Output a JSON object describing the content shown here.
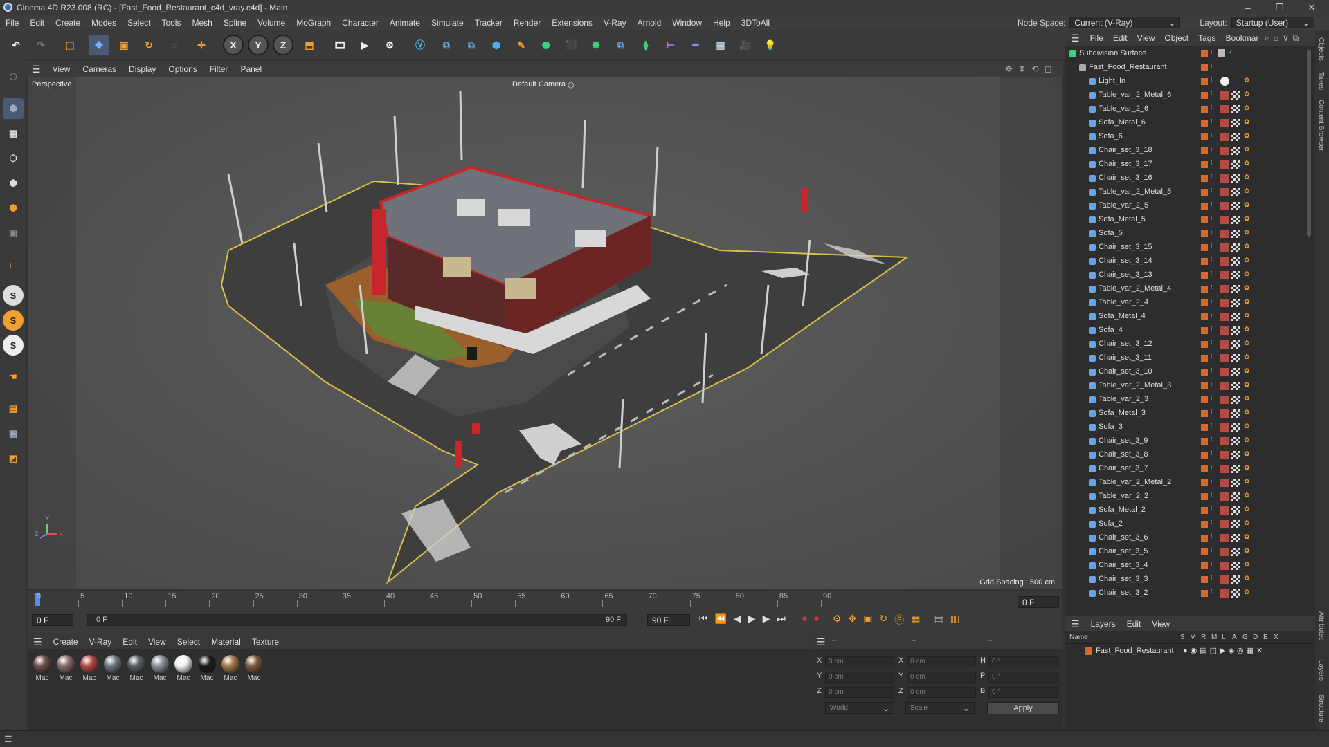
{
  "window": {
    "title": "Cinema 4D R23.008 (RC) - [Fast_Food_Restaurant_c4d_vray.c4d] - Main",
    "controls": [
      "–",
      "❐",
      "✕"
    ]
  },
  "menubar": {
    "items": [
      "File",
      "Edit",
      "Create",
      "Modes",
      "Select",
      "Tools",
      "Mesh",
      "Spline",
      "Volume",
      "MoGraph",
      "Character",
      "Animate",
      "Simulate",
      "Tracker",
      "Render",
      "Extensions",
      "V-Ray",
      "Arnold",
      "Window",
      "Help",
      "3DToAll"
    ],
    "node_space_label": "Node Space:",
    "node_space_value": "Current (V-Ray)",
    "layout_label": "Layout:",
    "layout_value": "Startup (User)"
  },
  "viewport": {
    "menu": [
      "View",
      "Cameras",
      "Display",
      "Options",
      "Filter",
      "Panel"
    ],
    "view_name": "Perspective",
    "camera": "Default Camera",
    "grid_spacing": "Grid Spacing : 500 cm",
    "axes": [
      "Y",
      "Z",
      "X"
    ]
  },
  "timeline": {
    "ticks": [
      "0",
      "5",
      "10",
      "15",
      "20",
      "25",
      "30",
      "35",
      "40",
      "45",
      "50",
      "55",
      "60",
      "65",
      "70",
      "75",
      "80",
      "85",
      "90"
    ],
    "frame_field": "0 F",
    "current_frame": "0 F",
    "start_frame": "0 F",
    "end_frame_range": "90 F",
    "end_frame": "90 F",
    "right_frame": "0 F"
  },
  "materials": {
    "menu": [
      "Create",
      "V-Ray",
      "Edit",
      "View",
      "Select",
      "Material",
      "Texture"
    ],
    "items": [
      {
        "label": "Mac",
        "color": "#6e4f4a"
      },
      {
        "label": "Mac",
        "color": "#8a6a66"
      },
      {
        "label": "Mac",
        "color": "#b44a44"
      },
      {
        "label": "Mac",
        "color": "#6d7380"
      },
      {
        "label": "Mac",
        "color": "#5a5d66"
      },
      {
        "label": "Mac",
        "color": "#8a8f99"
      },
      {
        "label": "Mac",
        "color": "#f2f2f2"
      },
      {
        "label": "Mac",
        "color": "#1c1c1c"
      },
      {
        "label": "Mac",
        "color": "#a07a48"
      },
      {
        "label": "Mac",
        "color": "#7a5a40"
      }
    ]
  },
  "coords": {
    "header_left": "--",
    "header_mid": "--",
    "header_right": "--",
    "rows": [
      {
        "a": "X",
        "av": "0 cm",
        "b": "X",
        "bv": "0 cm",
        "c": "H",
        "cv": "0 °"
      },
      {
        "a": "Y",
        "av": "0 cm",
        "b": "Y",
        "bv": "0 cm",
        "c": "P",
        "cv": "0 °"
      },
      {
        "a": "Z",
        "av": "0 cm",
        "b": "Z",
        "bv": "0 cm",
        "c": "B",
        "cv": "0 °"
      }
    ],
    "mode": "World",
    "scale": "Scale",
    "apply": "Apply"
  },
  "objects": {
    "menu": [
      "File",
      "Edit",
      "View",
      "Object",
      "Tags",
      "Bookmar"
    ],
    "top_item": "Subdivision Surface",
    "root": "Fast_Food_Restaurant",
    "children": [
      "Light_In",
      "Table_var_2_Metal_6",
      "Table_var_2_6",
      "Sofa_Metal_6",
      "Sofa_6",
      "Chair_set_3_18",
      "Chair_set_3_17",
      "Chair_set_3_16",
      "Table_var_2_Metal_5",
      "Table_var_2_5",
      "Sofa_Metal_5",
      "Sofa_5",
      "Chair_set_3_15",
      "Chair_set_3_14",
      "Chair_set_3_13",
      "Table_var_2_Metal_4",
      "Table_var_2_4",
      "Sofa_Metal_4",
      "Sofa_4",
      "Chair_set_3_12",
      "Chair_set_3_11",
      "Chair_set_3_10",
      "Table_var_2_Metal_3",
      "Table_var_2_3",
      "Sofa_Metal_3",
      "Sofa_3",
      "Chair_set_3_9",
      "Chair_set_3_8",
      "Chair_set_3_7",
      "Table_var_2_Metal_2",
      "Table_var_2_2",
      "Sofa_Metal_2",
      "Sofa_2",
      "Chair_set_3_6",
      "Chair_set_3_5",
      "Chair_set_3_4",
      "Chair_set_3_3",
      "Chair_set_3_2"
    ]
  },
  "layers": {
    "menu": [
      "Layers",
      "Edit",
      "View"
    ],
    "columns": [
      "Name",
      "S",
      "V",
      "R",
      "M",
      "L",
      "A",
      "G",
      "D",
      "E",
      "X"
    ],
    "rows": [
      "Fast_Food_Restaurant"
    ]
  },
  "sidetabs": [
    "Objects",
    "Takes",
    "Content Browser",
    "Attributes",
    "Layers",
    "Structure"
  ],
  "colors": {
    "accent": "#e0652a",
    "object_layer": "#d86a2a"
  }
}
